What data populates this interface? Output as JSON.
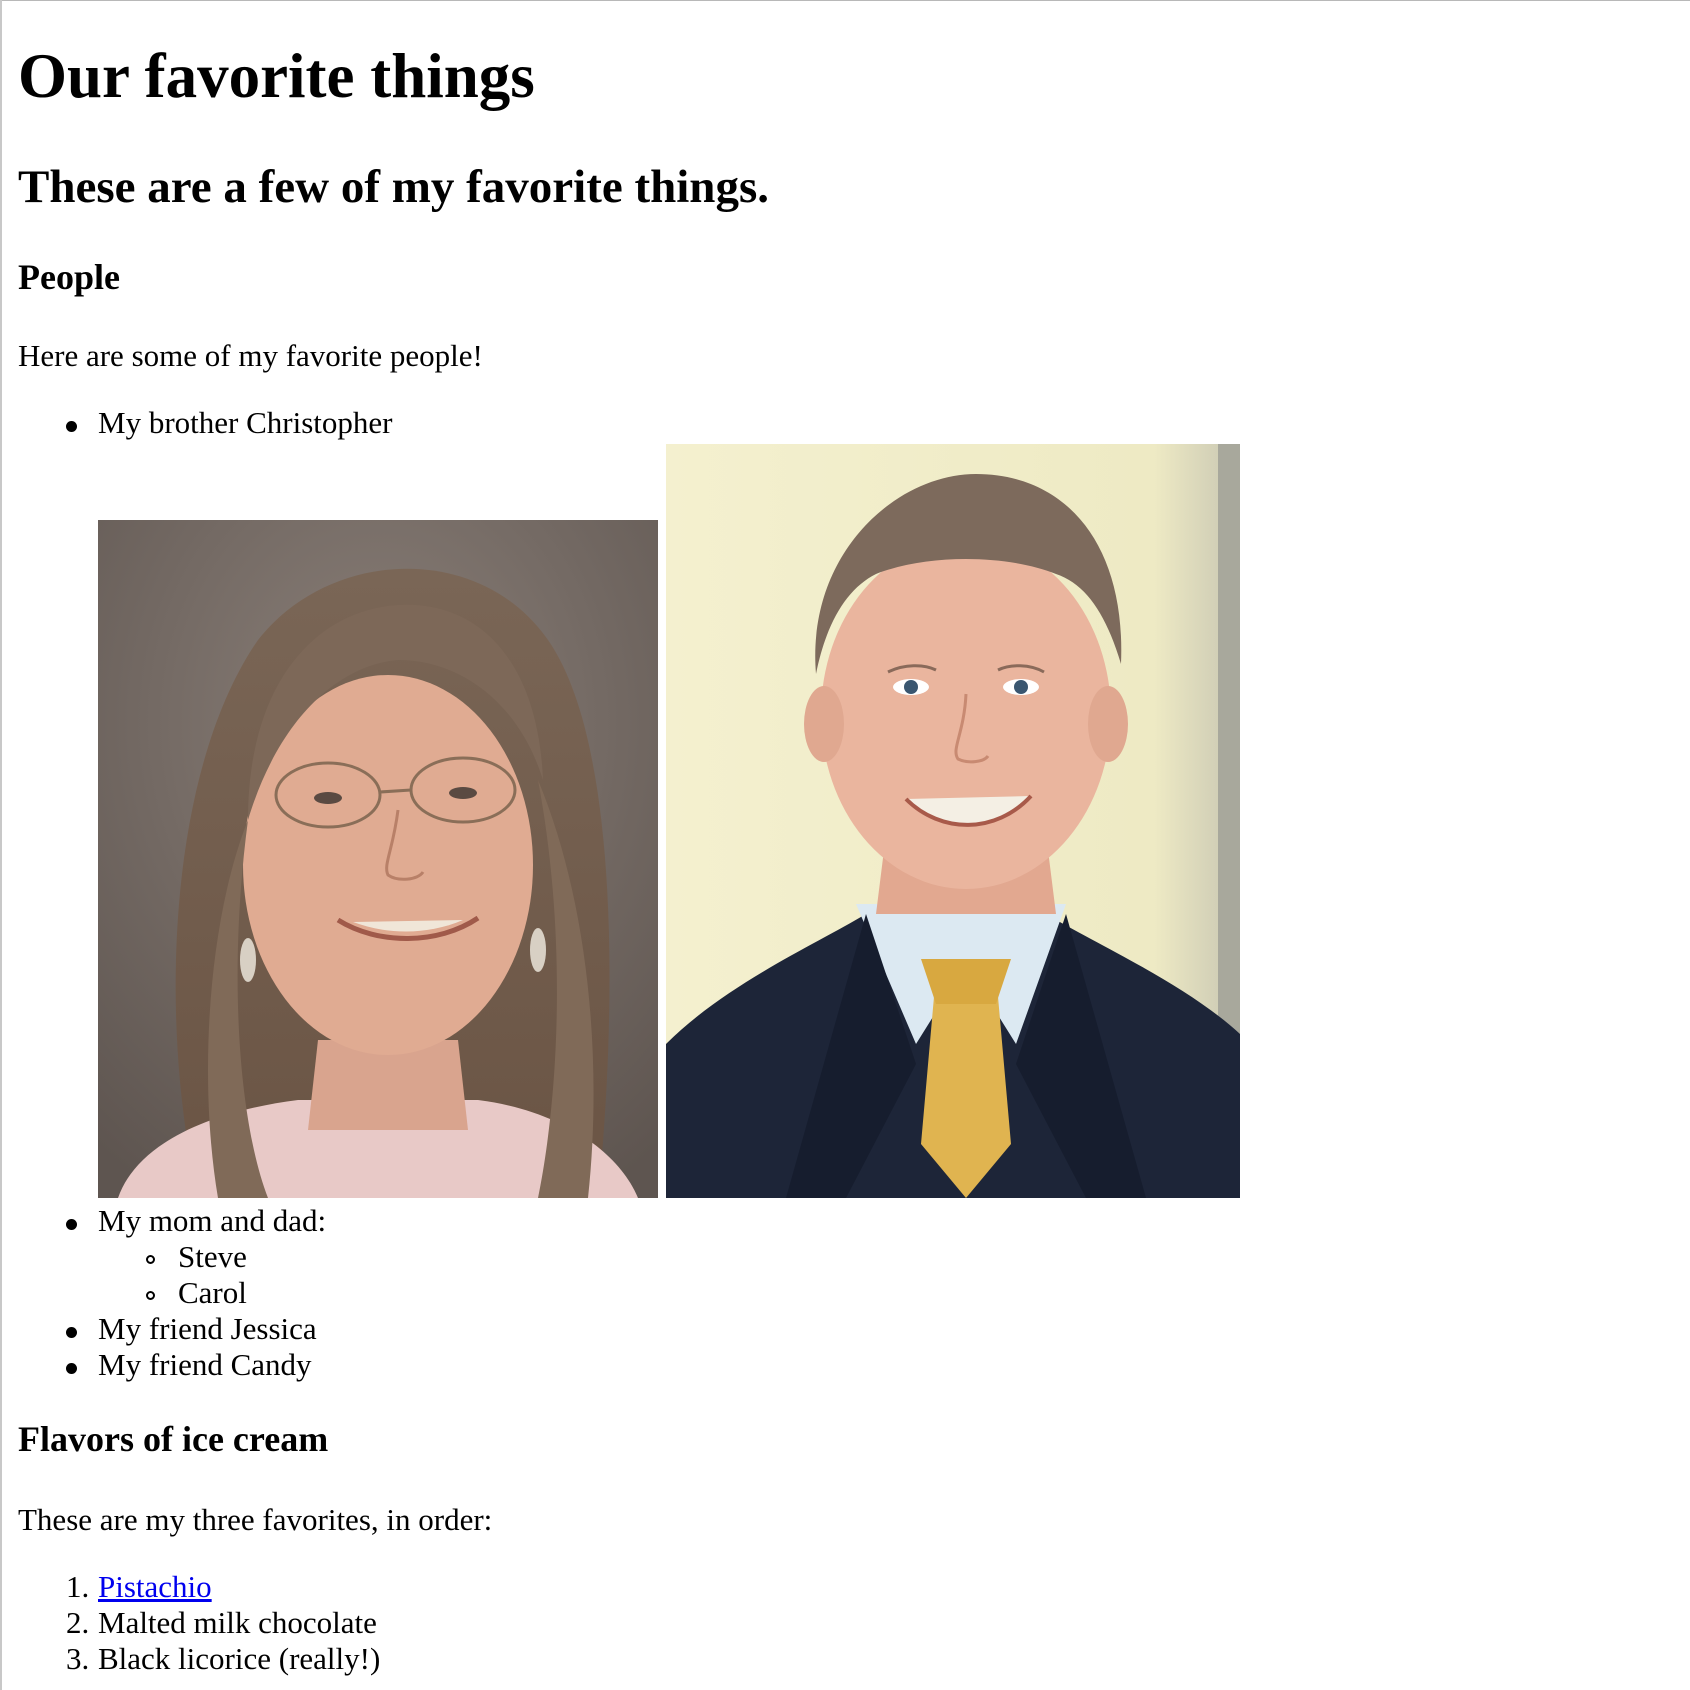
{
  "page": {
    "title": "Our favorite things",
    "subtitle": "These are a few of my favorite things."
  },
  "people": {
    "heading": "People",
    "intro": "Here are some of my favorite people!",
    "items": [
      {
        "label": "My brother Christopher"
      },
      {
        "label": "My mom and dad:",
        "subitems": [
          "Steve",
          "Carol"
        ]
      },
      {
        "label": "My friend Jessica"
      },
      {
        "label": "My friend Candy"
      }
    ],
    "photos": [
      {
        "name": "woman-photo"
      },
      {
        "name": "man-photo"
      }
    ]
  },
  "ice_cream": {
    "heading": "Flavors of ice cream",
    "intro": "These are my three favorites, in order:",
    "items": [
      {
        "number": "1.",
        "label": "Pistachio",
        "is_link": true
      },
      {
        "number": "2.",
        "label": "Malted milk chocolate"
      },
      {
        "number": "3.",
        "label": "Black licorice (really!)"
      }
    ]
  },
  "colors": {
    "link": "#0000ee",
    "text": "#000000",
    "background": "#ffffff"
  }
}
